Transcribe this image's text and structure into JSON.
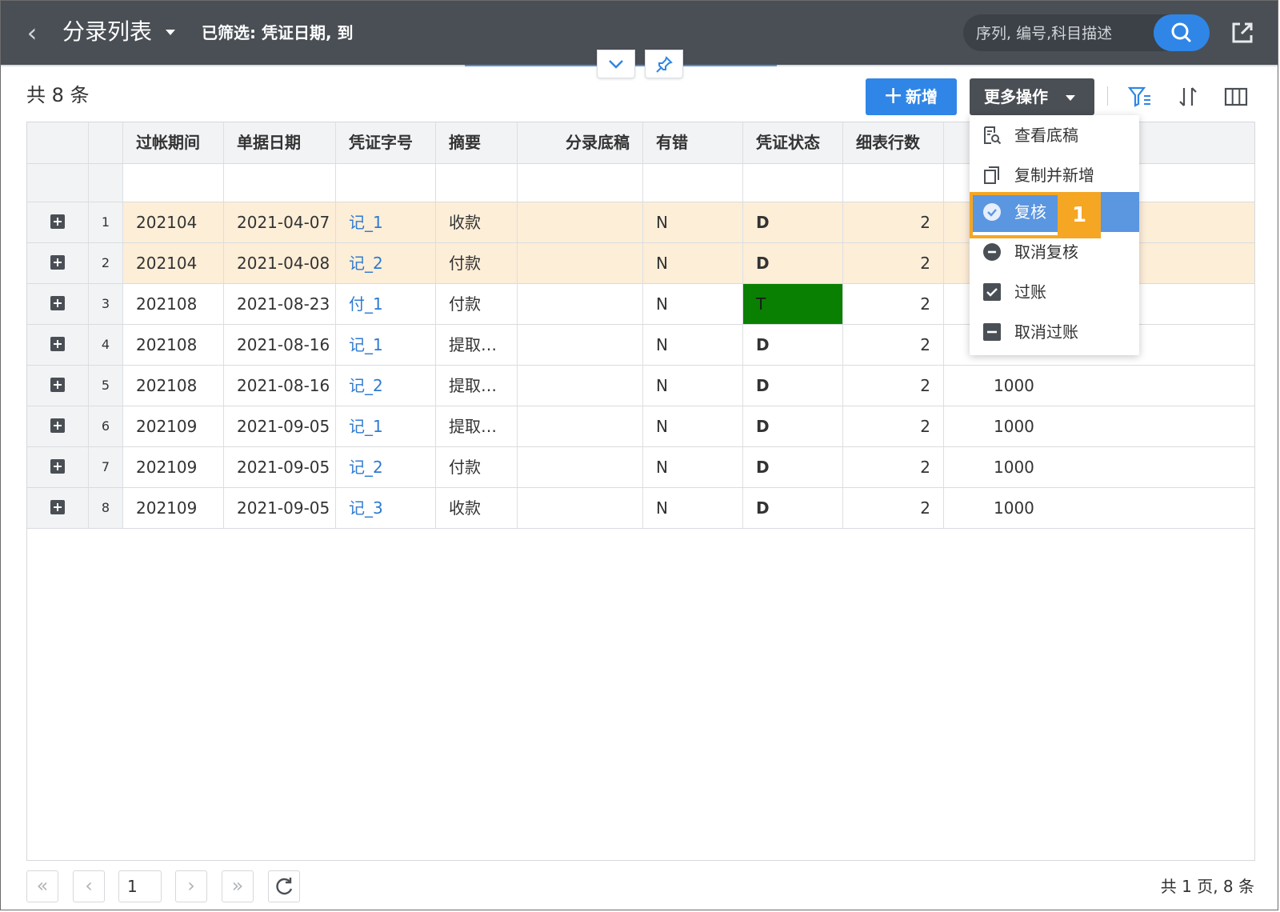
{
  "header": {
    "title": "分录列表",
    "filter_info": "已筛选: 凭证日期, 到",
    "search_placeholder": "序列, 编号,科目描述"
  },
  "toolbar": {
    "total": "共 8 条",
    "add_label": "新增",
    "more_label": "更多操作"
  },
  "grid": {
    "columns": [
      "过帐期间",
      "单据日期",
      "凭证字号",
      "摘要",
      "分录底稿",
      "有错",
      "凭证状态",
      "细表行数"
    ],
    "rows": [
      {
        "num": "1",
        "period": "202104",
        "date": "2021-04-07",
        "voucher": "记_1",
        "summary": "收款",
        "err": "N",
        "status": "D",
        "lines": "2",
        "amount": ""
      },
      {
        "num": "2",
        "period": "202104",
        "date": "2021-04-08",
        "voucher": "记_2",
        "summary": "付款",
        "err": "N",
        "status": "D",
        "lines": "2",
        "amount": ""
      },
      {
        "num": "3",
        "period": "202108",
        "date": "2021-08-23",
        "voucher": "付_1",
        "summary": "付款",
        "err": "N",
        "status": "T",
        "lines": "2",
        "amount": ""
      },
      {
        "num": "4",
        "period": "202108",
        "date": "2021-08-16",
        "voucher": "记_1",
        "summary": "提取…",
        "err": "N",
        "status": "D",
        "lines": "2",
        "amount": ""
      },
      {
        "num": "5",
        "period": "202108",
        "date": "2021-08-16",
        "voucher": "记_2",
        "summary": "提取…",
        "err": "N",
        "status": "D",
        "lines": "2",
        "amount": "1000"
      },
      {
        "num": "6",
        "period": "202109",
        "date": "2021-09-05",
        "voucher": "记_1",
        "summary": "提取…",
        "err": "N",
        "status": "D",
        "lines": "2",
        "amount": "1000"
      },
      {
        "num": "7",
        "period": "202109",
        "date": "2021-09-05",
        "voucher": "记_2",
        "summary": "付款",
        "err": "N",
        "status": "D",
        "lines": "2",
        "amount": "1000"
      },
      {
        "num": "8",
        "period": "202109",
        "date": "2021-09-05",
        "voucher": "记_3",
        "summary": "收款",
        "err": "N",
        "status": "D",
        "lines": "2",
        "amount": "1000"
      }
    ]
  },
  "menu": {
    "items": [
      {
        "label": "查看底稿",
        "icon": "view-draft-icon"
      },
      {
        "label": "复制并新增",
        "icon": "copy-icon"
      },
      {
        "label": "复核",
        "icon": "check-circle-icon",
        "active": true
      },
      {
        "label": "取消复核",
        "icon": "minus-circle-icon"
      },
      {
        "label": "过账",
        "icon": "checkbox-checked-icon"
      },
      {
        "label": "取消过账",
        "icon": "checkbox-minus-icon"
      }
    ],
    "step_badge": "1"
  },
  "pager": {
    "current": "1",
    "summary": "共 1 页, 8 条"
  },
  "colors": {
    "header_bg": "#4a4f55",
    "primary": "#2f86e6",
    "row_highlight": "#fdeed8",
    "status_T": "#0a8003",
    "step_badge": "#f5a623"
  }
}
